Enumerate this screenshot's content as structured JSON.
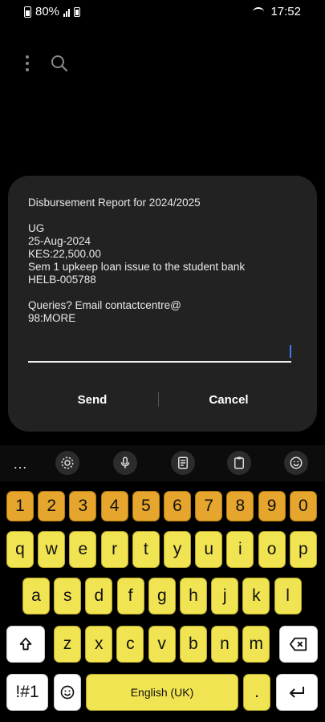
{
  "status_bar": {
    "battery": "80%",
    "time": "17:52"
  },
  "dialog": {
    "message_lines": [
      "Disbursement Report for 2024/2025",
      "",
      "UG",
      "25-Aug-2024",
      "KES:22,500.00",
      "Sem 1 upkeep loan issue to the student bank",
      "HELB-005788",
      "",
      "Queries? Email contactcentre@",
      "98:MORE"
    ],
    "input_value": "",
    "send_label": "Send",
    "cancel_label": "Cancel"
  },
  "keyboard": {
    "toolbar_more": "…",
    "row_numbers": [
      "1",
      "2",
      "3",
      "4",
      "5",
      "6",
      "7",
      "8",
      "9",
      "0"
    ],
    "row_top": [
      "q",
      "w",
      "e",
      "r",
      "t",
      "y",
      "u",
      "i",
      "o",
      "p"
    ],
    "row_middle": [
      "a",
      "s",
      "d",
      "f",
      "g",
      "h",
      "j",
      "k",
      "l"
    ],
    "row_bottom": [
      "z",
      "x",
      "c",
      "v",
      "b",
      "n",
      "m"
    ],
    "symbols_label": "!#1",
    "space_label": "English (UK)",
    "period_label": ".",
    "colors": {
      "letter_key": "#f1e452",
      "number_key": "#e6a52c",
      "function_key": "#ffffff"
    }
  }
}
